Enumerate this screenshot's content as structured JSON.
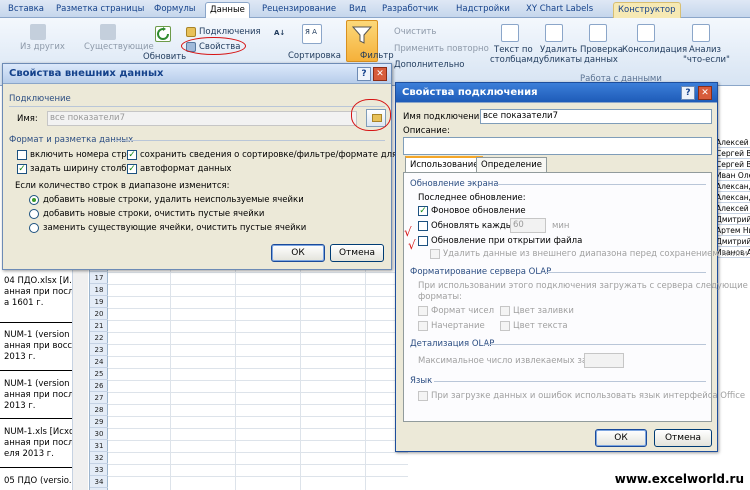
{
  "ribbon": {
    "tabs": [
      "Вставка",
      "Разметка страницы",
      "Формулы",
      "Данные",
      "Рецензирование",
      "Вид",
      "Разработчик",
      "Надстройки",
      "XY Chart Labels",
      "Конструктор"
    ],
    "active_tab": "Данные",
    "items": {
      "from_other": "Из других",
      "existing": "Существующие",
      "refresh": "Обновить",
      "connections": "Подключения",
      "properties": "Свойства",
      "sort": "Сортировка",
      "filter": "Фильтр",
      "clear": "Очистить",
      "reapply": "Применить повторно",
      "advanced": "Дополнительно",
      "text_to_columns_1": "Текст по",
      "text_to_columns_2": "столбцам",
      "remove_duplicates_1": "Удалить",
      "remove_duplicates_2": "дубликаты",
      "validation_1": "Проверка",
      "validation_2": "данных",
      "consolidate": "Консолидация",
      "whatif_1": "Анализ",
      "whatif_2": "\"что-если\"",
      "group_data": "Работа с данными"
    }
  },
  "external_dialog": {
    "title": "Свойства внешних данных",
    "connection_section": "Подключение",
    "name_label": "Имя:",
    "name_value": "все показатели7",
    "format_section": "Формат и разметка данных",
    "cb_row_numbers": "включить номера строк",
    "cb_preserve_sort": "сохранить сведения о сортировке/фильтре/формате для столбца",
    "cb_col_width": "задать ширину столбца",
    "cb_autoformat": "автоформат данных",
    "range_change_label": "Если количество строк в диапазоне изменится:",
    "radio_1": "добавить новые строки, удалить неиспользуемые ячейки",
    "radio_2": "добавить новые строки, очистить пустые ячейки",
    "radio_3": "заменить существующие ячейки, очистить пустые ячейки",
    "ok": "ОК",
    "cancel": "Отмена"
  },
  "conn_dialog": {
    "title": "Свойства подключения",
    "name_label": "Имя подключения:",
    "name_value": "все показатели7",
    "desc_label": "Описание:",
    "tab_usage": "Использование",
    "tab_definition": "Определение",
    "refresh_section": "Обновление экрана",
    "last_refresh": "Последнее обновление:",
    "bg_refresh": "Фоновое обновление",
    "refresh_every": "Обновлять каждые",
    "refresh_minutes_value": "60",
    "minutes_unit": "мин",
    "refresh_on_open": "Обновление при открытии файла",
    "remove_data": "Удалить данные из внешнего диапазона перед сохранением книги",
    "olap_section": "Форматирование сервера OLAP",
    "olap_desc_1": "При использовании этого подключения загружать с сервера следующие",
    "olap_desc_2": "форматы:",
    "fmt_number": "Формат чисел",
    "fill_color": "Цвет заливки",
    "font_style": "Начертание",
    "text_color": "Цвет текста",
    "drill_section": "Детализация OLAP",
    "max_records": "Максимальное число извлекаемых записей:",
    "lang_section": "Язык",
    "lang_desc": "При загрузке данных и ошибок использовать язык интерфейса Office",
    "ok": "ОК",
    "cancel": "Отмена"
  },
  "left_panel": {
    "lines": [
      "04 ПДО.xlsx  [И...",
      "анная при посл...",
      "а 1601 г.",
      "NUM-1 (version 1...",
      "анная при восс...",
      "2013 г.",
      "NUM-1 (version 1...",
      "анная при посл...",
      "2013 г.",
      "NUM-1.xls  [Исхо...",
      "анная при посл...",
      "еля 2013 г.",
      "05 ПДО (versio..."
    ]
  },
  "row_numbers": [
    "16",
    "17",
    "18",
    "19",
    "20",
    "21",
    "22",
    "23",
    "24",
    "25",
    "26",
    "27",
    "28",
    "29",
    "30",
    "31",
    "32",
    "33",
    "34",
    "35",
    "36",
    "37",
    "38"
  ],
  "right_cells": [
    "Алексей Ник",
    "Сергей Вла",
    "Сергей Вла",
    "Иван Оле",
    "Александр",
    "Александр",
    "Алексей Анат",
    "Дмитрий Ни",
    "Артем Нико",
    "Дмитрий Ю",
    "Иванов Артем"
  ],
  "watermark": "www.excelworld.ru"
}
